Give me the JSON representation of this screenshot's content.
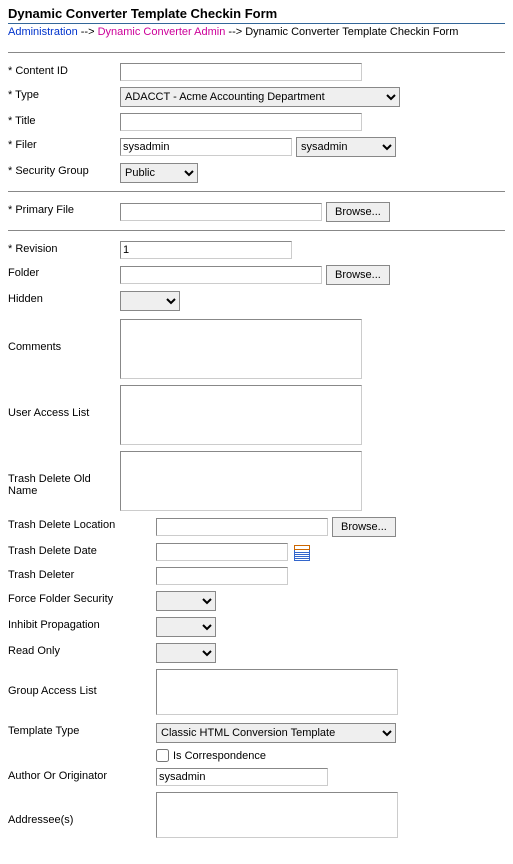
{
  "page": {
    "title": "Dynamic Converter Template Checkin Form"
  },
  "breadcrumb": {
    "admin": "Administration",
    "sep": "-->",
    "dca": "Dynamic Converter Admin",
    "current": "Dynamic Converter Template Checkin Form"
  },
  "labels": {
    "content_id": "* Content ID",
    "type": "* Type",
    "title": "* Title",
    "filer": "* Filer",
    "security_group": "* Security Group",
    "primary_file": "* Primary File",
    "revision": "* Revision",
    "folder": "Folder",
    "hidden": "Hidden",
    "comments": "Comments",
    "user_access_list": "User Access List",
    "trash_delete_old_name": "Trash Delete Old Name",
    "trash_delete_location": "Trash Delete Location",
    "trash_delete_date": "Trash Delete Date",
    "trash_deleter": "Trash Deleter",
    "force_folder_security": "Force Folder Security",
    "inhibit_propagation": "Inhibit Propagation",
    "read_only": "Read Only",
    "group_access_list": "Group Access List",
    "template_type": "Template Type",
    "is_correspondence": "Is Correspondence",
    "author_or_originator": "Author Or Originator",
    "addressees": "Addressee(s)"
  },
  "values": {
    "content_id": "",
    "type": "ADACCT - Acme Accounting Department",
    "title": "",
    "filer_input": "sysadmin",
    "filer_select": "sysadmin",
    "security_group": "Public",
    "primary_file": "",
    "revision": "1",
    "folder": "",
    "hidden": "",
    "comments": "",
    "user_access_list": "",
    "trash_delete_old_name": "",
    "trash_delete_location": "",
    "trash_delete_date": "",
    "trash_deleter": "",
    "force_folder_security": "",
    "inhibit_propagation": "",
    "read_only": "",
    "group_access_list": "",
    "template_type": "Classic HTML Conversion Template",
    "author_or_originator": "sysadmin",
    "addressees": ""
  },
  "buttons": {
    "browse": "Browse..."
  }
}
